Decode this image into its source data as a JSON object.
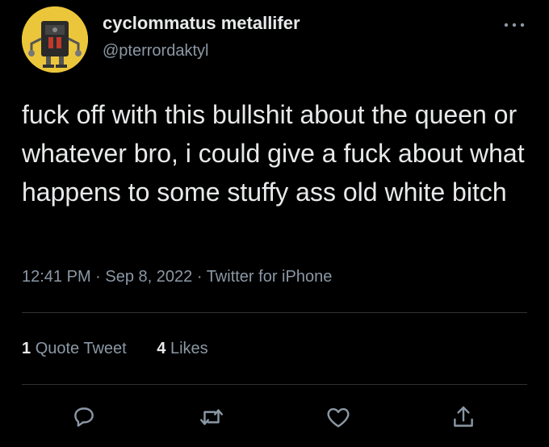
{
  "author": {
    "display_name": "cyclommatus metallifer",
    "handle": "@pterrordaktyl"
  },
  "tweet": {
    "text": "fuck off with this bullshit about the queen or whatever bro, i could give a fuck about what happens to some stuffy ass old white bitch"
  },
  "meta": {
    "time": "12:41 PM",
    "separator1": " · ",
    "date": "Sep 8, 2022",
    "separator2": " · ",
    "source": "Twitter for iPhone"
  },
  "stats": {
    "quote_count": "1",
    "quote_label": "Quote Tweet",
    "like_count": "4",
    "like_label": "Likes"
  },
  "icons": {
    "more": "more-horizontal-icon",
    "reply": "reply-bubble-icon",
    "retweet": "retweet-icon",
    "like": "heart-icon",
    "share": "share-icon"
  },
  "colors": {
    "background": "#000000",
    "primary_text": "#e7e9ea",
    "secondary_text": "#8b98a5",
    "divider": "#2f3336",
    "avatar_bg": "#ecc63a"
  }
}
